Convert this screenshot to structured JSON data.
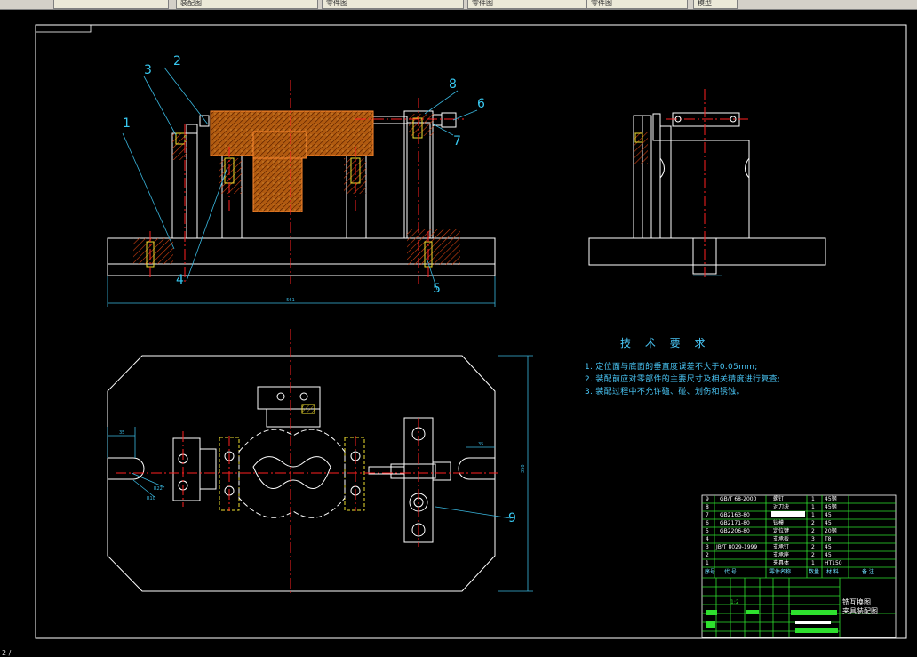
{
  "tabs": [
    {
      "label": ""
    },
    {
      "label": "装配图"
    },
    {
      "label": "零件图"
    },
    {
      "label": "零件图"
    },
    {
      "label": "零件图"
    },
    {
      "label": "模型"
    },
    {
      "label": ""
    }
  ],
  "callouts": [
    "1",
    "2",
    "3",
    "4",
    "5",
    "6",
    "7",
    "8",
    "9"
  ],
  "dimensions": {
    "front_width": "561",
    "top_height": "350",
    "left_offset": "35",
    "right_offset": "35",
    "radius_a": "R22",
    "radius_b": "R10"
  },
  "technical_requirements": {
    "title": "技 术 要 求",
    "items": [
      "1. 定位面与底面的垂直度误差不大于0.05mm;",
      "2. 装配前应对零部件的主要尺寸及相关精度进行复查;",
      "3. 装配过程中不允许磕、碰、划伤和锈蚀。"
    ]
  },
  "parts_list": {
    "header": [
      "序号",
      "代 号",
      "零件名称",
      "数量",
      "材 料",
      "备 注"
    ],
    "rows": [
      {
        "no": "9",
        "code": "GB/T 68-2000",
        "name": "螺钉",
        "qty": "1",
        "material": "45钢"
      },
      {
        "no": "8",
        "code": "",
        "name": "对刀块",
        "qty": "1",
        "material": "45钢"
      },
      {
        "no": "7",
        "code": "GB2163-80",
        "name": "",
        "qty": "1",
        "material": "45"
      },
      {
        "no": "6",
        "code": "GB2171-80",
        "name": "钻模",
        "qty": "2",
        "material": "45"
      },
      {
        "no": "5",
        "code": "GB2206-80",
        "name": "定位键",
        "qty": "2",
        "material": "20钢"
      },
      {
        "no": "4",
        "code": "",
        "name": "支承板",
        "qty": "3",
        "material": "T8"
      },
      {
        "no": "3",
        "code": "JB/T 8029-1999",
        "name": "支承钉",
        "qty": "2",
        "material": "45"
      },
      {
        "no": "2",
        "code": "",
        "name": "支承座",
        "qty": "2",
        "material": "45"
      },
      {
        "no": "1",
        "code": "",
        "name": "夹具体",
        "qty": "1",
        "material": "HT150"
      }
    ]
  },
  "title_block": {
    "name_line1": "铣互换图",
    "name_line2": "夹具装配图",
    "scale": "1:2"
  },
  "status_text": "2 /"
}
